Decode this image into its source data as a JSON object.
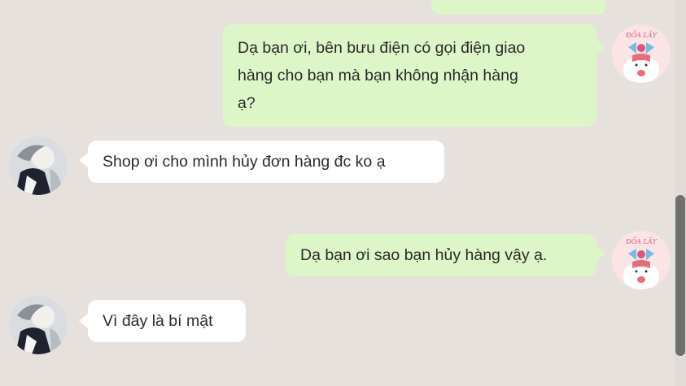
{
  "messages": [
    {
      "text": "",
      "direction": "outgoing",
      "partial": true
    },
    {
      "lines": [
        "Dạ bạn ơi, bên bưu điện có gọi điện giao",
        "hàng cho bạn mà bạn không nhận hàng",
        "ạ?"
      ],
      "direction": "outgoing"
    },
    {
      "text": "Shop ơi cho mình hủy đơn hàng đc ko ạ",
      "direction": "incoming"
    },
    {
      "text": "Dạ bạn ơi sao bạn hủy hàng vậy ạ.",
      "direction": "outgoing"
    },
    {
      "text": "Vì đây là bí mật",
      "direction": "incoming"
    }
  ],
  "avatars": {
    "shop_logo_text": "ĐỒA LẤY",
    "shop_icon": "cartoon-shop-avatar-icon",
    "customer_icon": "customer-photo-avatar-icon"
  },
  "colors": {
    "background": "#e7e1dd",
    "outgoing_bubble": "#dcf6c8",
    "incoming_bubble": "#ffffff"
  }
}
